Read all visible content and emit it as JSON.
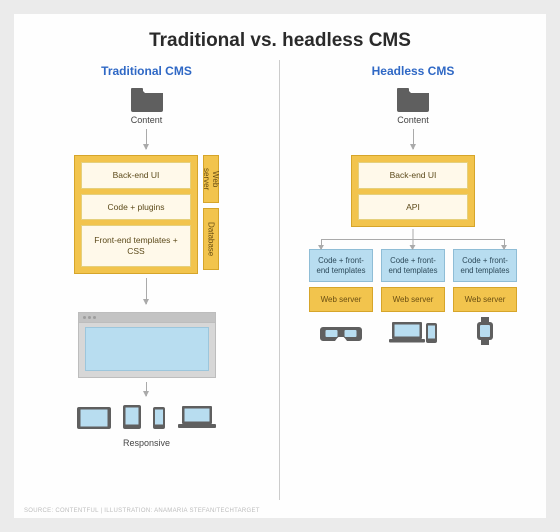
{
  "title": "Traditional vs. headless CMS",
  "traditional": {
    "heading": "Traditional CMS",
    "content_label": "Content",
    "stack": {
      "backend": "Back-end UI",
      "code": "Code + plugins",
      "frontend": "Front-end templates + CSS"
    },
    "sidebars": {
      "web_server": "Web server",
      "database": "Database"
    },
    "responsive_label": "Responsive"
  },
  "headless": {
    "heading": "Headless CMS",
    "content_label": "Content",
    "stack": {
      "backend": "Back-end UI",
      "api": "API"
    },
    "consumer": {
      "code_fe": "Code + front-end templates",
      "web_server": "Web server"
    }
  },
  "credit": "SOURCE: CONTENTFUL | ILLUSTRATION: ANAMARIA STEFAN/TECHTARGET"
}
